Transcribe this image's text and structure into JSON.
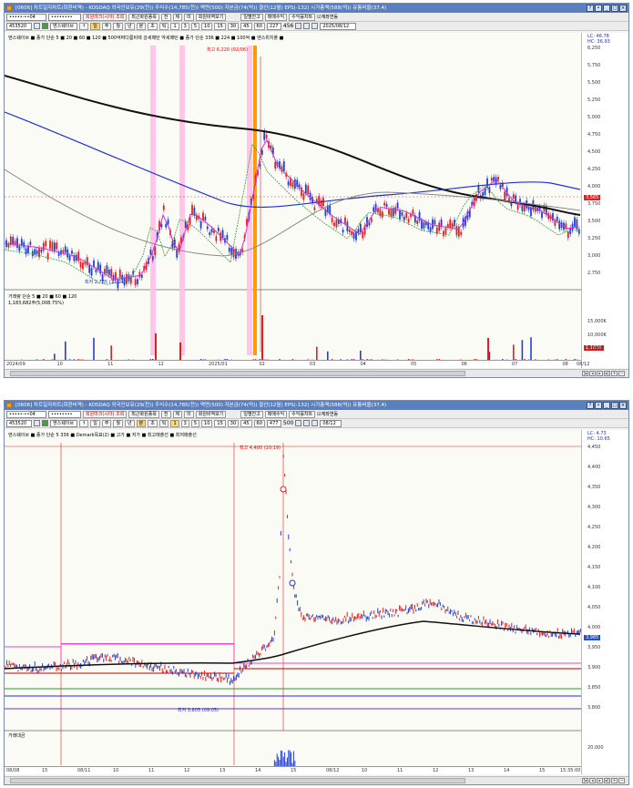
{
  "colors": {
    "titlebar": "#5a7fbf",
    "up": "#e02020",
    "down": "#2040d0",
    "ma_long": "#111111",
    "ma_blue": "#2030d0",
    "ma_magenta": "#d030d0",
    "ma_green": "#30a030",
    "highlight_pink": "#ffc0e8",
    "highlight_orange": "#ff9a00"
  },
  "chart1": {
    "title": "[0606] 차트일자차트(화환비역) - KOSDAQ 외국인보유(29(천)) 주식수(14,785(천)) 액면(500) 자본금(74(억)) 결산(12월) EPS(-132) 시가총액(588(억)) 유통비율(37.4)",
    "toolbar": {
      "code": "453520",
      "name": "엔스웨이브",
      "buttons": [
        "회원마크(시아) 조회",
        "최근화원종목",
        "전",
        "체",
        "미",
        "회원비역보기",
        "일별잔고",
        "매매수익",
        "수익률차트"
      ],
      "account": "계좌연동",
      "periods": [
        "일",
        "주",
        "월",
        "년",
        "분",
        "초",
        "틱"
      ],
      "minutes": [
        "1",
        "3",
        "5",
        "10",
        "15",
        "30",
        "45",
        "60"
      ],
      "count": "227",
      "total": "456",
      "date": "2025/08/12"
    },
    "legend_top": "엔스웨이브 ■ 종가 단순 5 ■ 20 ■ 60 ■ 120 ■ 500억짜다름비례 강세패턴 약세패턴 ■ 종가 단순 336 ■ 224 ■ 100억 ■ 엔스위치플 ■",
    "legend_vol": "거래량 단순 5 ■ 20 ■ 60 ■ 120",
    "vol_value": "1,183,682주(5,008.75%)",
    "high_label": "최고 6,220 (02/06)",
    "low_label": "최저 2,735 (11/21)",
    "price_tag": "3,565",
    "vol_tag": "1,183K",
    "price_ticks": [
      "6,250",
      "5,750",
      "5,500",
      "5,250",
      "5,000",
      "4,750",
      "4,500",
      "4,250",
      "4,000",
      "3,750",
      "3,500",
      "3,250",
      "3,000",
      "2,750"
    ],
    "vol_ticks": [
      "15,000K",
      "10,000K",
      "5,000K"
    ],
    "x_labels": [
      "2024/09",
      "10",
      "11",
      "12",
      "2025/01",
      "02",
      "03",
      "04",
      "05",
      "06",
      "07",
      "08"
    ],
    "x_end": "08/12",
    "side_top": "LC: 46.78",
    "side_top2": "HC: 36.93"
  },
  "chart2": {
    "title": "[0606] 차트일자차트(화환비역) - KOSDAQ 외국인보유(29(천)) 주식수(14,785(천)) 액면(500) 자본금(74(억)) 결산(12월) EPS(-132) 시가총액(588(억)) 유통비율(37.4)",
    "toolbar": {
      "code": "453520",
      "name": "엔스웨이브",
      "count": "477",
      "total": "500",
      "date": "08/12"
    },
    "legend_top": "엔스웨이브 ■ 종가 단순 5 336 ■ Demark목표(2) ■ 고가 ■ 저가 ■ 최고매출선 ■ 최저매출선",
    "legend_vol": "거래대금",
    "high_label": "최고 4,400 (10:19)",
    "low_label": "최저 3,805 (09:05)",
    "price_tag": "3,985",
    "price_ticks": [
      "4,450",
      "4,400",
      "4,350",
      "4,300",
      "4,250",
      "4,200",
      "4,150",
      "4,100",
      "4,050",
      "4,000",
      "3,950",
      "3,900",
      "3,850",
      "3,800"
    ],
    "vol_ticks": [
      "20,000"
    ],
    "x_labels": [
      "08/08",
      "15",
      "08/11",
      "10",
      "11",
      "12",
      "13",
      "14",
      "15",
      "08/12",
      "10",
      "11",
      "12",
      "13",
      "14",
      "15"
    ],
    "x_end": "15:35:00",
    "side_top": "LC: 4.73",
    "side_top2": "HC: 10.65"
  }
}
